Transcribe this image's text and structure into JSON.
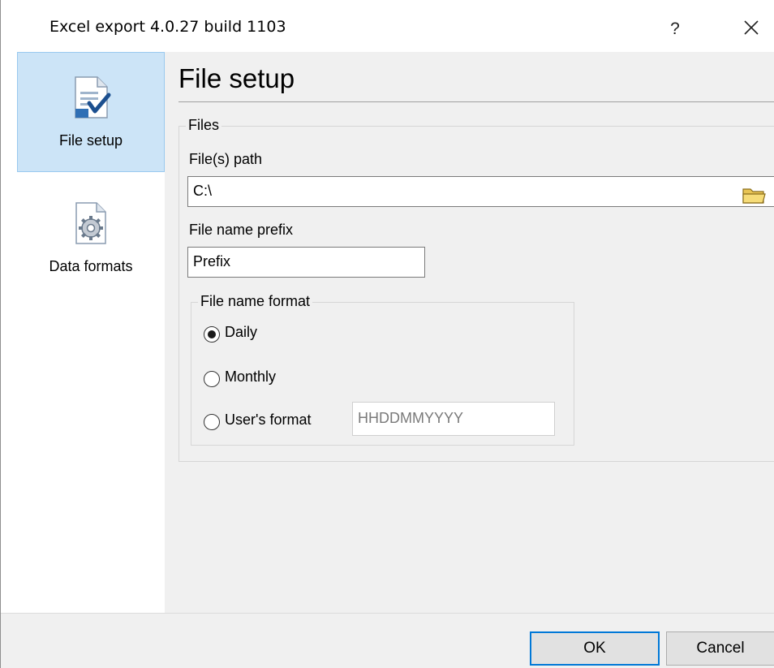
{
  "window": {
    "title": "Excel export 4.0.27 build 1103",
    "help_label": "?",
    "close_icon": "close-icon"
  },
  "sidebar": {
    "items": [
      {
        "label": "File setup",
        "icon": "document-checkmark-icon",
        "selected": true
      },
      {
        "label": "Data formats",
        "icon": "document-gear-icon",
        "selected": false
      }
    ]
  },
  "main": {
    "title": "File setup",
    "files_group": {
      "legend": "Files",
      "path_label": "File(s) path",
      "path_value": "C:\\",
      "browse_icon": "folder-icon",
      "prefix_label": "File name prefix",
      "prefix_value": "Prefix",
      "format_group": {
        "legend": "File name format",
        "options": [
          {
            "label": "Daily",
            "checked": true
          },
          {
            "label": "Monthly",
            "checked": false
          },
          {
            "label": "User's format",
            "checked": false
          }
        ],
        "user_format_value": "HHDDMMYYYY"
      }
    }
  },
  "footer": {
    "ok_label": "OK",
    "cancel_label": "Cancel"
  },
  "colors": {
    "accent": "#0078d7",
    "selected_bg": "#cce4f7",
    "dialog_bg": "#f0f0f0"
  }
}
